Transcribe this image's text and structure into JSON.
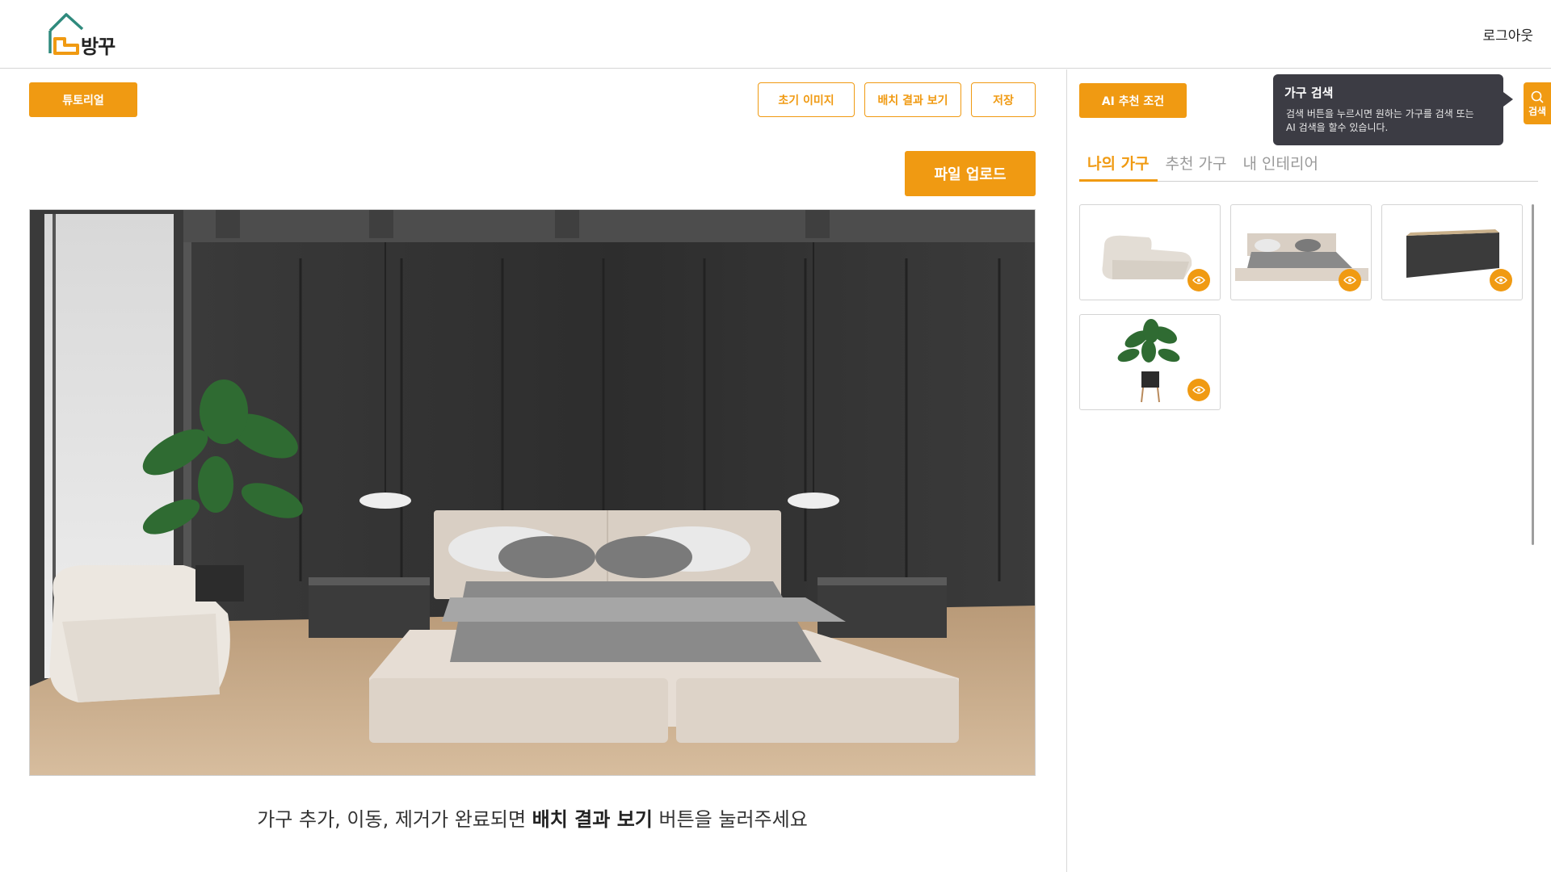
{
  "brand": {
    "name": "방꾸",
    "accent": "#f09a12"
  },
  "header": {
    "logout_label": "로그아웃"
  },
  "toolbar": {
    "tutorial_label": "튜토리얼",
    "initial_image_label": "초기 이미지",
    "view_result_label": "배치 결과 보기",
    "save_label": "저장",
    "upload_label": "파일 업로드"
  },
  "caption": {
    "prefix": "가구 추가, 이동, 제거가 완료되면 ",
    "emphasis": "배치 결과 보기",
    "suffix": " 버튼을 눌러주세요"
  },
  "sidebar": {
    "ai_condition_label": "AI 추천 조건",
    "search_label": "검색",
    "tooltip": {
      "title": "가구 검색",
      "line1": "검색 버튼을 누르시면 원하는 가구를 검색 또는",
      "line2": "AI 검색을 할수 있습니다."
    },
    "tabs": [
      {
        "label": "나의 가구",
        "active": true
      },
      {
        "label": "추천 가구",
        "active": false
      },
      {
        "label": "내 인테리어",
        "active": false
      }
    ],
    "furniture": [
      {
        "name": "sofa"
      },
      {
        "name": "bed"
      },
      {
        "name": "side-table"
      },
      {
        "name": "plant"
      }
    ]
  }
}
